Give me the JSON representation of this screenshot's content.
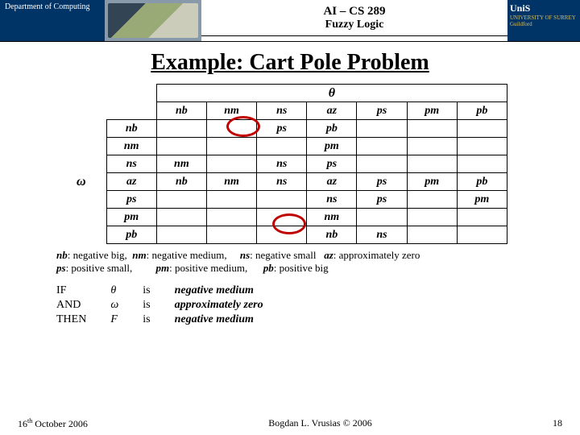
{
  "header": {
    "dept": "Department of Computing",
    "course": "AI – CS 289",
    "topic": "Fuzzy Logic",
    "uni": "UniS",
    "uni_sub1": "UNIVERSITY OF SURREY",
    "uni_sub2": "Guildford"
  },
  "title": "Example: Cart Pole Problem",
  "axis": {
    "theta": "θ",
    "omega": "ω"
  },
  "cols": [
    "nb",
    "nm",
    "ns",
    "az",
    "ps",
    "pm",
    "pb"
  ],
  "rows": {
    "nb": [
      "",
      "",
      "ps",
      "pb",
      "",
      "",
      ""
    ],
    "nm": [
      "",
      "",
      "",
      "pm",
      "",
      "",
      ""
    ],
    "ns": [
      "nm",
      "",
      "ns",
      "ps",
      "",
      "",
      ""
    ],
    "az": [
      "nb",
      "nm",
      "ns",
      "az",
      "ps",
      "pm",
      "pb"
    ],
    "ps": [
      "",
      "",
      "",
      "ns",
      "ps",
      "",
      "pm"
    ],
    "pm": [
      "",
      "",
      "",
      "nm",
      "",
      "",
      ""
    ],
    "pb": [
      "",
      "",
      "",
      "nb",
      "ns",
      "",
      ""
    ]
  },
  "legend": {
    "l1a": "nb",
    "l1b": ": negative big,",
    "l2a": "nm",
    "l2b": ": negative medium,",
    "l3a": "ns",
    "l3b": ": negative small",
    "l4a": "az",
    "l4b": ": approximately zero",
    "l5a": "ps",
    "l5b": ": positive small,",
    "l6a": "pm",
    "l6b": ": positive medium,",
    "l7a": "pb",
    "l7b": ": positive big"
  },
  "rule": {
    "if": "IF",
    "and": "AND",
    "then": "THEN",
    "v1": "θ",
    "v2": "ω",
    "v3": "F",
    "is": "is",
    "r1": "negative medium",
    "r2": "approximately zero",
    "r3": "negative medium"
  },
  "footer": {
    "date_pre": "16",
    "date_sup": "th",
    "date_post": " October 2006",
    "author": "Bogdan L. Vrusias © 2006",
    "page": "18"
  }
}
